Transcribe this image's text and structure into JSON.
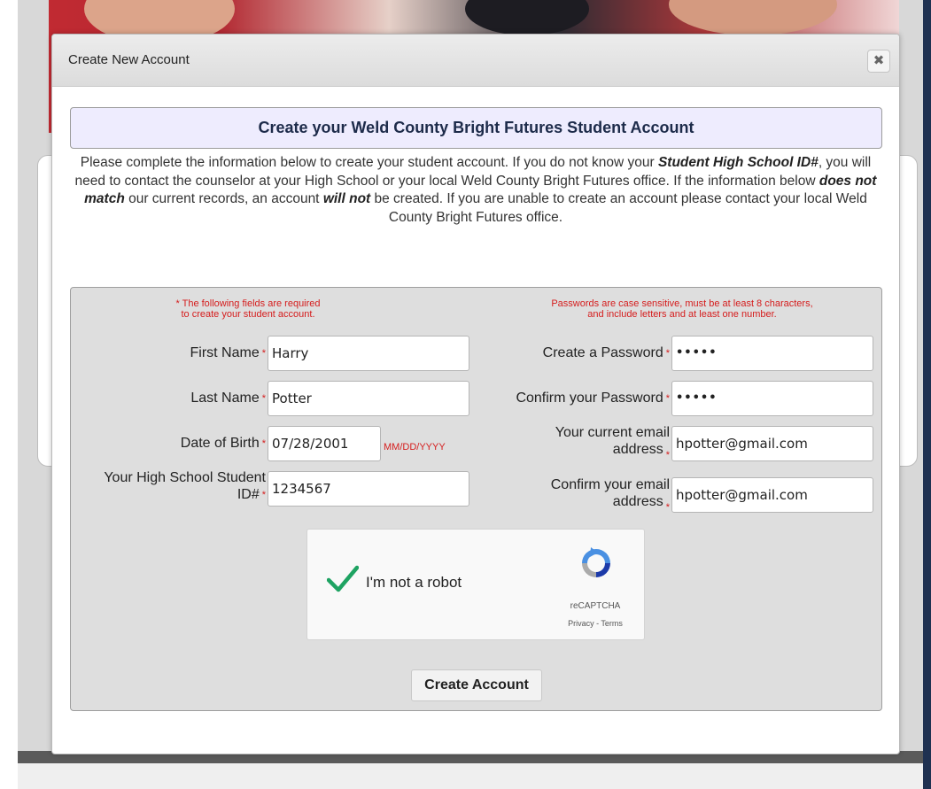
{
  "modal": {
    "title": "Create New Account",
    "close_glyph": "✖",
    "banner": "Create your Weld County Bright Futures Student Account",
    "intro": {
      "p1": "Please complete the information below to create your student account. If you do not know your ",
      "b1": "Student High School ID#",
      "p2": ", you will need to contact the counselor at your High School or your local Weld County Bright Futures office. If the information below ",
      "b2": "does not match",
      "p3": " our current records, an account ",
      "b3": "will not",
      "p4": " be created. If you are unable to create an account please contact your local Weld County Bright Futures office."
    }
  },
  "form": {
    "required_note": [
      "* The following fields are required",
      "to create your student account."
    ],
    "password_note": [
      "Passwords are case sensitive, must be at least 8 characters,",
      "and include letters and at least one number."
    ],
    "required_marker": "*",
    "first_name": {
      "label": "First Name",
      "value": "Harry"
    },
    "last_name": {
      "label": "Last Name",
      "value": "Potter"
    },
    "dob": {
      "label": "Date of Birth",
      "value": "07/28/2001",
      "hint": "MM/DD/YYYY"
    },
    "student_id": {
      "label_line1": "Your High School Student",
      "label_line2": "ID#",
      "value": "1234567"
    },
    "password": {
      "label": "Create a Password",
      "value": "•••••"
    },
    "confirm_password": {
      "label": "Confirm your Password",
      "value": "•••••"
    },
    "email": {
      "label_line1": "Your current email",
      "label_line2": "address",
      "value": "hpotter@gmail.com"
    },
    "confirm_email": {
      "label_line1": "Confirm your email",
      "label_line2": "address",
      "value": "hpotter@gmail.com"
    },
    "captcha": {
      "label": "I'm not a robot",
      "brand": "reCAPTCHA",
      "links": "Privacy - Terms",
      "checked": true,
      "check_color": "#1ea362"
    },
    "submit_label": "Create Account"
  }
}
